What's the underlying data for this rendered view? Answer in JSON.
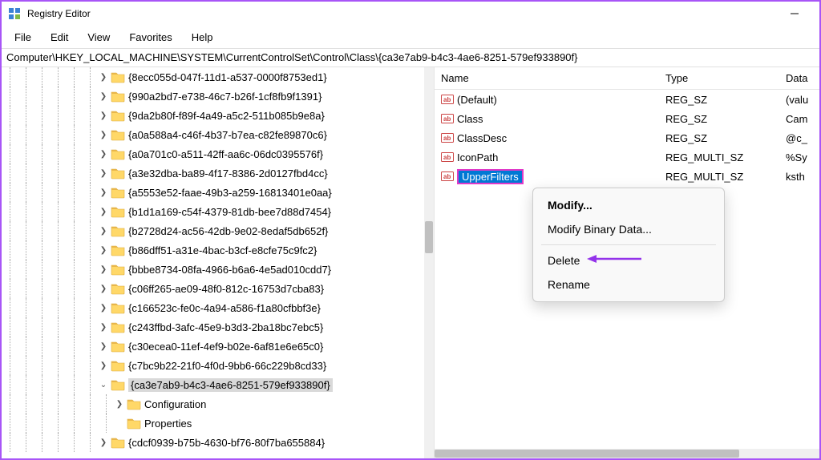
{
  "window": {
    "title": "Registry Editor"
  },
  "menu": {
    "items": [
      "File",
      "Edit",
      "View",
      "Favorites",
      "Help"
    ]
  },
  "address": {
    "path": "Computer\\HKEY_LOCAL_MACHINE\\SYSTEM\\CurrentControlSet\\Control\\Class\\{ca3e7ab9-b4c3-4ae6-8251-579ef933890f}"
  },
  "tree": {
    "indent_base": 6,
    "nodes": [
      {
        "indent": 6,
        "chev": "r",
        "label": "{8ecc055d-047f-11d1-a537-0000f8753ed1}"
      },
      {
        "indent": 6,
        "chev": "r",
        "label": "{990a2bd7-e738-46c7-b26f-1cf8fb9f1391}"
      },
      {
        "indent": 6,
        "chev": "r",
        "label": "{9da2b80f-f89f-4a49-a5c2-511b085b9e8a}"
      },
      {
        "indent": 6,
        "chev": "r",
        "label": "{a0a588a4-c46f-4b37-b7ea-c82fe89870c6}"
      },
      {
        "indent": 6,
        "chev": "r",
        "label": "{a0a701c0-a511-42ff-aa6c-06dc0395576f}"
      },
      {
        "indent": 6,
        "chev": "r",
        "label": "{a3e32dba-ba89-4f17-8386-2d0127fbd4cc}"
      },
      {
        "indent": 6,
        "chev": "r",
        "label": "{a5553e52-faae-49b3-a259-16813401e0aa}"
      },
      {
        "indent": 6,
        "chev": "r",
        "label": "{b1d1a169-c54f-4379-81db-bee7d88d7454}"
      },
      {
        "indent": 6,
        "chev": "r",
        "label": "{b2728d24-ac56-42db-9e02-8edaf5db652f}"
      },
      {
        "indent": 6,
        "chev": "r",
        "label": "{b86dff51-a31e-4bac-b3cf-e8cfe75c9fc2}"
      },
      {
        "indent": 6,
        "chev": "r",
        "label": "{bbbe8734-08fa-4966-b6a6-4e5ad010cdd7}"
      },
      {
        "indent": 6,
        "chev": "r",
        "label": "{c06ff265-ae09-48f0-812c-16753d7cba83}"
      },
      {
        "indent": 6,
        "chev": "r",
        "label": "{c166523c-fe0c-4a94-a586-f1a80cfbbf3e}"
      },
      {
        "indent": 6,
        "chev": "r",
        "label": "{c243ffbd-3afc-45e9-b3d3-2ba18bc7ebc5}"
      },
      {
        "indent": 6,
        "chev": "r",
        "label": "{c30ecea0-11ef-4ef9-b02e-6af81e6e65c0}"
      },
      {
        "indent": 6,
        "chev": "r",
        "label": "{c7bc9b22-21f0-4f0d-9bb6-66c229b8cd33}"
      },
      {
        "indent": 6,
        "chev": "d",
        "label": "{ca3e7ab9-b4c3-4ae6-8251-579ef933890f}",
        "selected": true
      },
      {
        "indent": 7,
        "chev": "r",
        "label": "Configuration"
      },
      {
        "indent": 7,
        "chev": "",
        "label": "Properties"
      },
      {
        "indent": 6,
        "chev": "r",
        "label": "{cdcf0939-b75b-4630-bf76-80f7ba655884}"
      }
    ]
  },
  "list": {
    "headers": {
      "name": "Name",
      "type": "Type",
      "data": "Data"
    },
    "rows": [
      {
        "name": "(Default)",
        "type": "REG_SZ",
        "data": "(valu"
      },
      {
        "name": "Class",
        "type": "REG_SZ",
        "data": "Cam"
      },
      {
        "name": "ClassDesc",
        "type": "REG_SZ",
        "data": "@c_"
      },
      {
        "name": "IconPath",
        "type": "REG_MULTI_SZ",
        "data": "%Sy"
      },
      {
        "name": "UpperFilters",
        "type": "REG_MULTI_SZ",
        "data": "ksth",
        "selected": true
      }
    ]
  },
  "context_menu": {
    "items": [
      {
        "label": "Modify...",
        "bold": true
      },
      {
        "label": "Modify Binary Data..."
      },
      {
        "sep": true
      },
      {
        "label": "Delete",
        "arrow": true
      },
      {
        "label": "Rename"
      }
    ]
  }
}
